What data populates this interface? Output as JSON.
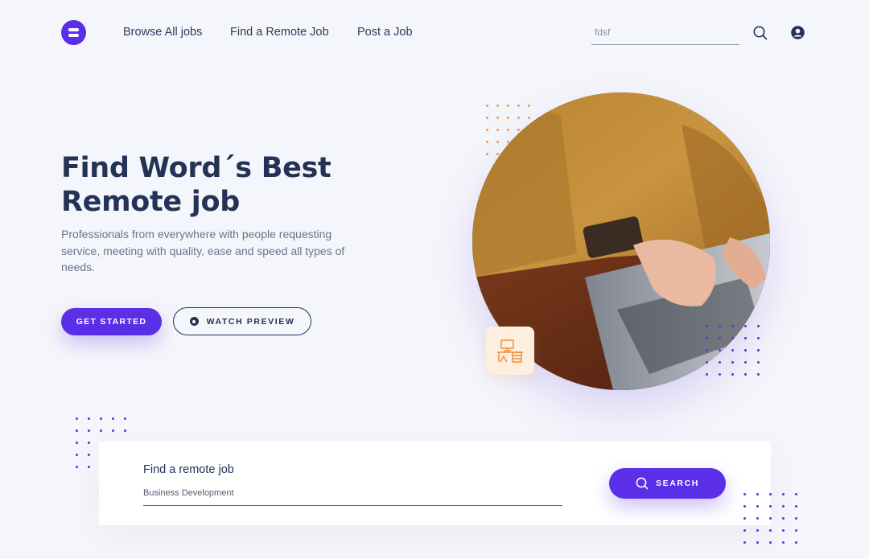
{
  "nav": {
    "logo_icon": "logo-icon",
    "links": [
      "Browse All jobs",
      "Find a Remote Job",
      "Post a Job"
    ],
    "search_value": "fdsf",
    "search_icon": "search-icon",
    "profile_icon": "user-circle-icon"
  },
  "hero": {
    "title_line1": "Find Word´s Best",
    "title_line2": "Remote job",
    "description": "Professionals from everywhere with people requesting service, meeting with quality, ease and speed all types of needs.",
    "primary_cta": "GET STARTED",
    "secondary_cta": "WATCH PREVIEW",
    "secondary_icon": "play-icon",
    "image_icon": "photo-person-laptop",
    "badge_icon": "desk-icon"
  },
  "search": {
    "label": "Find a remote job",
    "placeholder": "Business Development",
    "button": "SEARCH",
    "button_icon": "search-icon"
  },
  "colors": {
    "primary": "#5b2ee8",
    "heading": "#233355",
    "body_text": "#6c7389",
    "background": "#f5f6fb",
    "accent_orange": "#f49a4a",
    "badge_bg": "#fdeedd"
  }
}
